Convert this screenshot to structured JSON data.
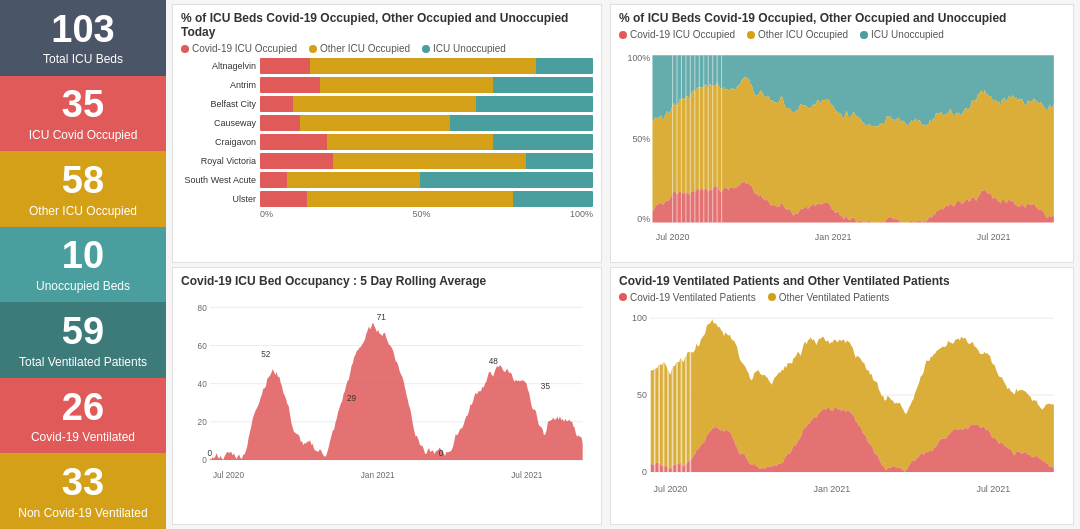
{
  "sidebar": {
    "cards": [
      {
        "number": "103",
        "label": "Total ICU Beds",
        "colorClass": "dark-gray"
      },
      {
        "number": "35",
        "label": "ICU Covid Occupied",
        "colorClass": "red"
      },
      {
        "number": "58",
        "label": "Other ICU Occupied",
        "colorClass": "yellow"
      },
      {
        "number": "10",
        "label": "Unoccupied Beds",
        "colorClass": "teal"
      },
      {
        "number": "59",
        "label": "Total Ventilated Patients",
        "colorClass": "dark-teal"
      },
      {
        "number": "26",
        "label": "Covid-19 Ventilated",
        "colorClass": "red2"
      },
      {
        "number": "33",
        "label": "Non Covid-19 Ventilated",
        "colorClass": "yellow2"
      }
    ]
  },
  "charts": {
    "top_left": {
      "title": "% of ICU Beds Covid-19 Occupied, Other Occupied and Unoccupied Today",
      "legend": [
        {
          "label": "Covid-19 ICU Occupied",
          "color": "#e05a5a"
        },
        {
          "label": "Other ICU Occupied",
          "color": "#d4a017"
        },
        {
          "label": "ICU Unoccupied",
          "color": "#4a9e9e"
        }
      ],
      "xLabels": [
        "0%",
        "50%",
        "100%"
      ],
      "hospitals": [
        {
          "name": "Altnagelvin",
          "covid": 15,
          "other": 68,
          "unoccupied": 17
        },
        {
          "name": "Antrim",
          "covid": 18,
          "other": 52,
          "unoccupied": 30
        },
        {
          "name": "Belfast City",
          "covid": 10,
          "other": 55,
          "unoccupied": 35
        },
        {
          "name": "Causeway",
          "covid": 12,
          "other": 45,
          "unoccupied": 43
        },
        {
          "name": "Craigavon",
          "covid": 20,
          "other": 50,
          "unoccupied": 30
        },
        {
          "name": "Royal Victoria",
          "covid": 22,
          "other": 58,
          "unoccupied": 20
        },
        {
          "name": "South West Acute",
          "covid": 8,
          "other": 40,
          "unoccupied": 52
        },
        {
          "name": "Ulster",
          "covid": 14,
          "other": 62,
          "unoccupied": 24
        }
      ]
    },
    "top_right": {
      "title": "% of ICU Beds Covid-19 Occupied, Other Occupied and Unoccupied",
      "legend": [
        {
          "label": "Covid-19 ICU Occupied",
          "color": "#e05a5a"
        },
        {
          "label": "Other ICU Occupied",
          "color": "#d4a017"
        },
        {
          "label": "ICU Unoccupied",
          "color": "#4a9e9e"
        }
      ],
      "xLabels": [
        "Jul 2020",
        "Jan 2021",
        "Jul 2021"
      ],
      "yLabels": [
        "100%",
        "50%",
        "0%"
      ]
    },
    "bottom_left": {
      "title": "Covid-19 ICU Bed Occupancy : 5 Day Rolling Average",
      "yMax": 80,
      "annotations": [
        "0",
        "52",
        "29",
        "71",
        "0",
        "48",
        "35"
      ],
      "xLabels": [
        "Jul 2020",
        "Jan 2021",
        "Jul 2021"
      ]
    },
    "bottom_right": {
      "title": "Covid-19 Ventilated Patients and Other Ventilated Patients",
      "legend": [
        {
          "label": "Covid-19 Ventilated Patients",
          "color": "#e05a5a"
        },
        {
          "label": "Other Ventilated Patients",
          "color": "#d4a017"
        }
      ],
      "yMax": 100,
      "xLabels": [
        "Jul 2020",
        "Jan 2021",
        "Jul 2021"
      ]
    }
  }
}
